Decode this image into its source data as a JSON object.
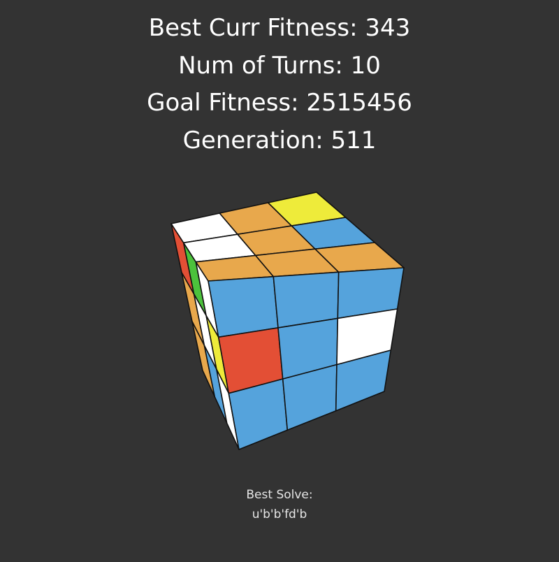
{
  "stats": {
    "best_curr_fitness": "Best Curr Fitness: 343",
    "num_turns": "Num of Turns: 10",
    "goal_fitness": "Goal Fitness: 2515456",
    "generation": "Generation: 511"
  },
  "best_solve": {
    "label": "Best Solve:",
    "moves": "u'b'b'fd'b"
  },
  "palette": {
    "white": "#ffffff",
    "orange": "#e8a84c",
    "yellow": "#eeeb3a",
    "blue": "#55a3dc",
    "red": "#e34f35",
    "green": "#4cc23c",
    "background": "#333333",
    "edge": "#111111"
  },
  "cube": {
    "top": [
      [
        "white",
        "orange",
        "yellow"
      ],
      [
        "white",
        "orange",
        "blue"
      ],
      [
        "orange",
        "orange",
        "orange"
      ]
    ],
    "front": [
      [
        "blue",
        "blue",
        "blue"
      ],
      [
        "red",
        "blue",
        "white"
      ],
      [
        "blue",
        "blue",
        "blue"
      ]
    ],
    "left": [
      [
        "red",
        "green",
        "white"
      ],
      [
        "orange",
        "white",
        "yellow"
      ],
      [
        "orange",
        "blue",
        "white"
      ]
    ]
  }
}
